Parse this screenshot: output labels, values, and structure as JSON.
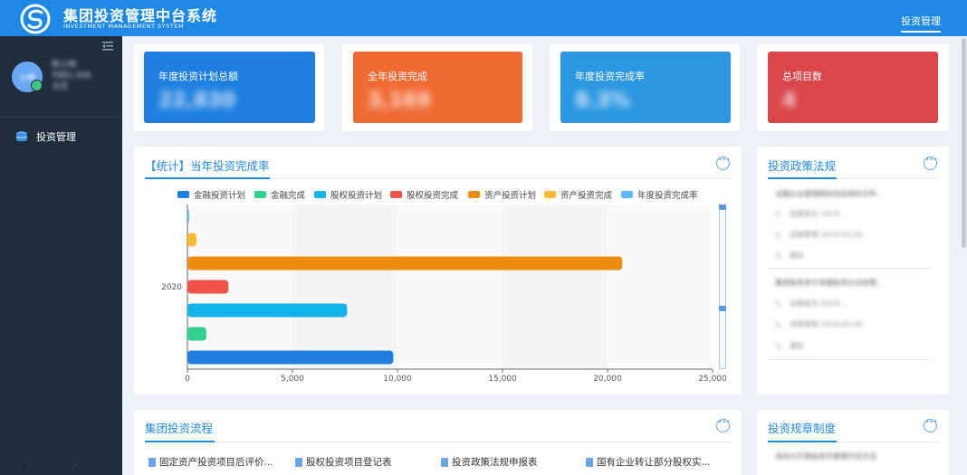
{
  "app": {
    "title": "集团投资管理中台系统",
    "subtitle": "INVESTMENT MANAGEMENT SYSTEM",
    "top_tab": "投资管理",
    "brand_color": "#1e88e5"
  },
  "user": {
    "avatar_text": "小明",
    "name": "陈小明",
    "dept": "代码1.008",
    "role": "主任"
  },
  "sidebar": {
    "items": [
      {
        "label": "投资管理",
        "icon": "database-icon"
      }
    ]
  },
  "stats": [
    {
      "label": "年度投资计划总额",
      "value": "22,830",
      "color": "#1e7fe0"
    },
    {
      "label": "全年投资完成",
      "value": "3,169",
      "color": "#f06a34"
    },
    {
      "label": "年度投资完成率",
      "value": "8.3%",
      "color": "#2b97e0"
    },
    {
      "label": "总项目数",
      "value": "4",
      "color": "#d9474b"
    }
  ],
  "chart_panel": {
    "title": "【统计】当年投资完成率"
  },
  "chart_data": {
    "type": "bar",
    "orientation": "horizontal",
    "categories": [
      "2020"
    ],
    "series": [
      {
        "name": "金融投资计划",
        "values": [
          9800
        ],
        "color": "#1e7fe0"
      },
      {
        "name": "金融完成",
        "values": [
          900
        ],
        "color": "#2fd090"
      },
      {
        "name": "股权投资计划",
        "values": [
          7600
        ],
        "color": "#11b3e8"
      },
      {
        "name": "股权投资完成",
        "values": [
          1950
        ],
        "color": "#f0524a"
      },
      {
        "name": "资产投资计划",
        "values": [
          20700
        ],
        "color": "#ed8c0e"
      },
      {
        "name": "资产投资完成",
        "values": [
          430
        ],
        "color": "#fdb833"
      },
      {
        "name": "年度投资完成率",
        "values": [
          80
        ],
        "color": "#5ab8ff"
      }
    ],
    "xlim": [
      0,
      25000
    ],
    "xticks": [
      "0",
      "5,000",
      "10,000",
      "15,000",
      "20,000",
      "25,000"
    ],
    "legend": "top",
    "grid": true
  },
  "policy_panel": {
    "title": "投资政策法规",
    "rows": [
      "话题企业管理相关培训资料文件...",
      "1、  话题发文  2019-...",
      "2、  决策管理  2019-03-24",
      "3、  通知",
      "集团投资关于加强投资企业经营...",
      "1、  话题发文  2019-...",
      "2、  决策管理  2019-05-09",
      "3、  通知"
    ]
  },
  "flow_panel": {
    "title": "集团投资流程",
    "items": [
      "固定资产投资项目后评价...",
      "股权投资项目登记表",
      "投资政策法规申报表",
      "国有企业转让部分股权实..."
    ]
  },
  "rules_panel": {
    "title": "投资规章制度",
    "rows": [
      "海法大厅固投资方管理方式方法"
    ]
  }
}
